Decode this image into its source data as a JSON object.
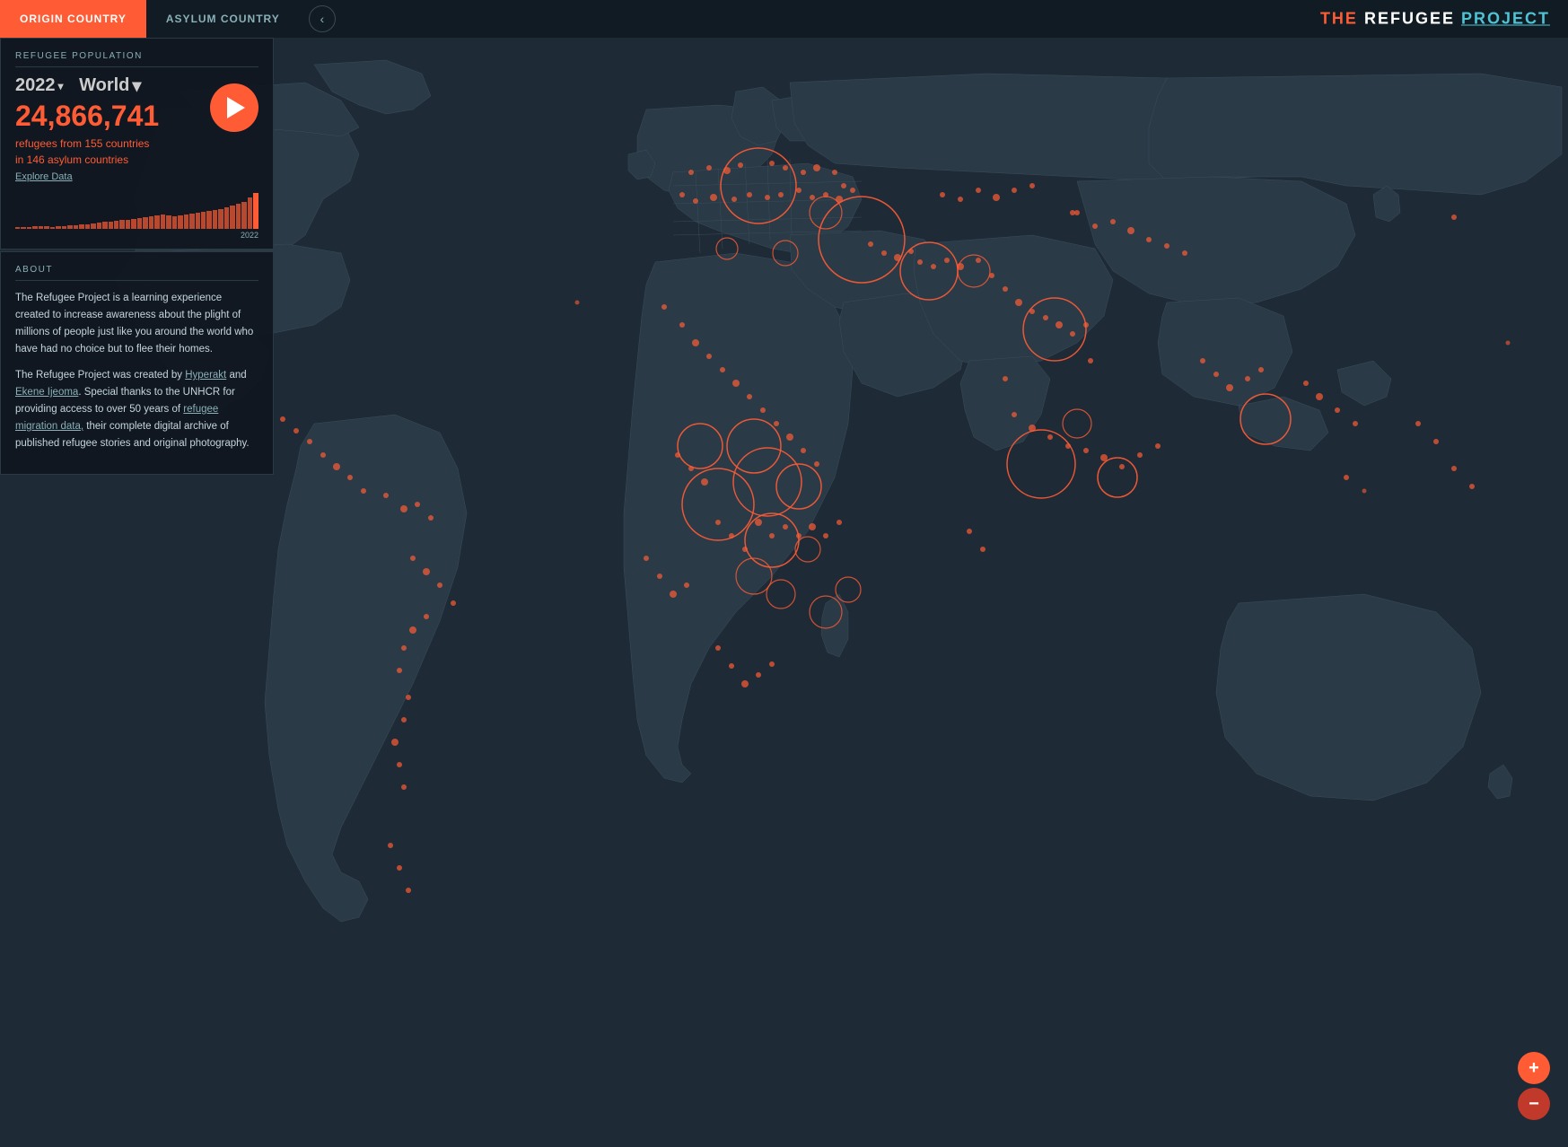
{
  "nav": {
    "origin_label": "ORIGIN COUNTRY",
    "asylum_label": "ASYLUM COUNTRY",
    "back_icon": "‹",
    "site_title_the": "THE ",
    "site_title_refugee": "REFUGEE ",
    "site_title_project": "PROJECT"
  },
  "stats": {
    "section_label": "REFUGEE POPULATION",
    "year": "2022",
    "year_arrow": "▾",
    "world": "World",
    "world_arrow": "▾",
    "big_number": "24,866,741",
    "description_line1": "refugees from 155 countries",
    "description_line2": "in 146 asylum countries",
    "explore_link": "Explore Data",
    "chart_year": "2022"
  },
  "about": {
    "section_label": "ABOUT",
    "paragraph1": "The Refugee Project is a learning experience created to increase awareness about the plight of millions of people just like you around the world who have had no choice but to flee their homes.",
    "paragraph2_prefix": "The Refugee Project was created by ",
    "hyperakt": "Hyperakt",
    "and": " and ",
    "ekene": "Ekene Ijeoma",
    "paragraph2_mid": ". Special thanks to the UNHCR for providing access to over 50 years of ",
    "refugee_migration_data": "refugee migration data,",
    "paragraph2_end": " their complete digital archive of published refugee stories and original photography."
  },
  "zoom": {
    "plus": "+",
    "minus": "−"
  },
  "colors": {
    "accent": "#ff5c35",
    "bg_dark": "#111b23",
    "bg_map": "#1e2a35",
    "text_muted": "#8ab0b8",
    "text_light": "#c5d5dd",
    "border": "#2a3a45",
    "circle_stroke": "#ff5c35"
  },
  "chart_bars": [
    2,
    2,
    2,
    3,
    3,
    3,
    2,
    3,
    3,
    4,
    4,
    5,
    5,
    6,
    7,
    8,
    8,
    9,
    10,
    10,
    11,
    12,
    13,
    14,
    15,
    16,
    15,
    14,
    15,
    16,
    17,
    18,
    19,
    20,
    21,
    22,
    24,
    26,
    28,
    30,
    35,
    40
  ]
}
